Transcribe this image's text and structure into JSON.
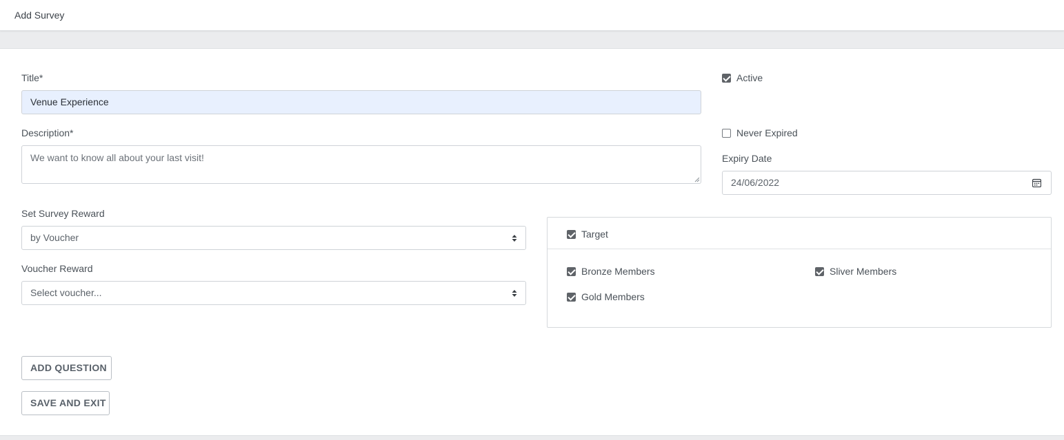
{
  "header": {
    "title": "Add Survey"
  },
  "form": {
    "title_label": "Title*",
    "title_value": "Venue Experience",
    "description_label": "Description*",
    "description_value": "We want to know all about your last visit!",
    "active_label": "Active",
    "active_checked": true,
    "never_expired_label": "Never Expired",
    "never_expired_checked": false,
    "expiry_date_label": "Expiry Date",
    "expiry_date_value": "24/06/2022",
    "reward_label": "Set Survey Reward",
    "reward_value": "by Voucher",
    "voucher_label": "Voucher Reward",
    "voucher_placeholder": "Select voucher..."
  },
  "target": {
    "label": "Target",
    "checked": true,
    "members": [
      {
        "label": "Bronze Members",
        "checked": true
      },
      {
        "label": "Sliver Members",
        "checked": true
      },
      {
        "label": "Gold Members",
        "checked": true
      }
    ]
  },
  "actions": {
    "add_question_label": "ADD QUESTION",
    "save_exit_label": "SAVE AND EXIT"
  },
  "colors": {
    "page_background": "#ebecee",
    "autofill_background": "#e8f0fe",
    "checkbox_checked": "#5f6368"
  }
}
